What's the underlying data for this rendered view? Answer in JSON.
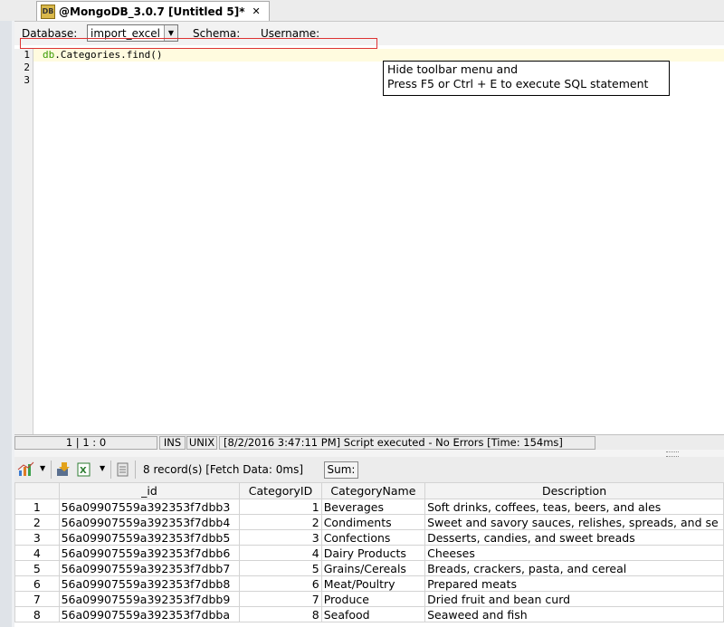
{
  "tab": {
    "title": "@MongoDB_3.0.7 [Untitled 5]*",
    "close": "✕"
  },
  "toolbar": {
    "database_label": "Database:",
    "database_value": "import_excel",
    "schema_label": "Schema:",
    "username_label": "Username:"
  },
  "editor": {
    "line_numbers": [
      "1",
      "2",
      "3"
    ],
    "code_kw": "db",
    "code_rest": ".Categories.find()",
    "tooltip_line1": "Hide toolbar menu and",
    "tooltip_line2": "Press F5 or Ctrl + E to execute SQL statement"
  },
  "statusbar": {
    "position": "1 | 1 : 0",
    "mode": "INS",
    "line_ending": "UNIX",
    "message": "[8/2/2016 3:47:11 PM] Script executed - No Errors [Time: 154ms]"
  },
  "results": {
    "record_count": "8 record(s) [Fetch Data: 0ms]",
    "sum_label": "Sum:",
    "columns": [
      "",
      "_id",
      "CategoryID",
      "CategoryName",
      "Description"
    ],
    "rows": [
      [
        "1",
        "56a09907559a392353f7dbb3",
        "1",
        "Beverages",
        "Soft drinks, coffees, teas, beers, and ales"
      ],
      [
        "2",
        "56a09907559a392353f7dbb4",
        "2",
        "Condiments",
        "Sweet and savory sauces, relishes, spreads, and se"
      ],
      [
        "3",
        "56a09907559a392353f7dbb5",
        "3",
        "Confections",
        "Desserts, candies, and sweet breads"
      ],
      [
        "4",
        "56a09907559a392353f7dbb6",
        "4",
        "Dairy Products",
        "Cheeses"
      ],
      [
        "5",
        "56a09907559a392353f7dbb7",
        "5",
        "Grains/Cereals",
        "Breads, crackers, pasta, and cereal"
      ],
      [
        "6",
        "56a09907559a392353f7dbb8",
        "6",
        "Meat/Poultry",
        "Prepared meats"
      ],
      [
        "7",
        "56a09907559a392353f7dbb9",
        "7",
        "Produce",
        "Dried fruit and bean curd"
      ],
      [
        "8",
        "56a09907559a392353f7dbba",
        "8",
        "Seafood",
        "Seaweed and fish"
      ]
    ]
  },
  "colors": {
    "keyword": "#3a9a00",
    "current_line": "#fffbdf",
    "highlight_box": "#dd3333"
  }
}
